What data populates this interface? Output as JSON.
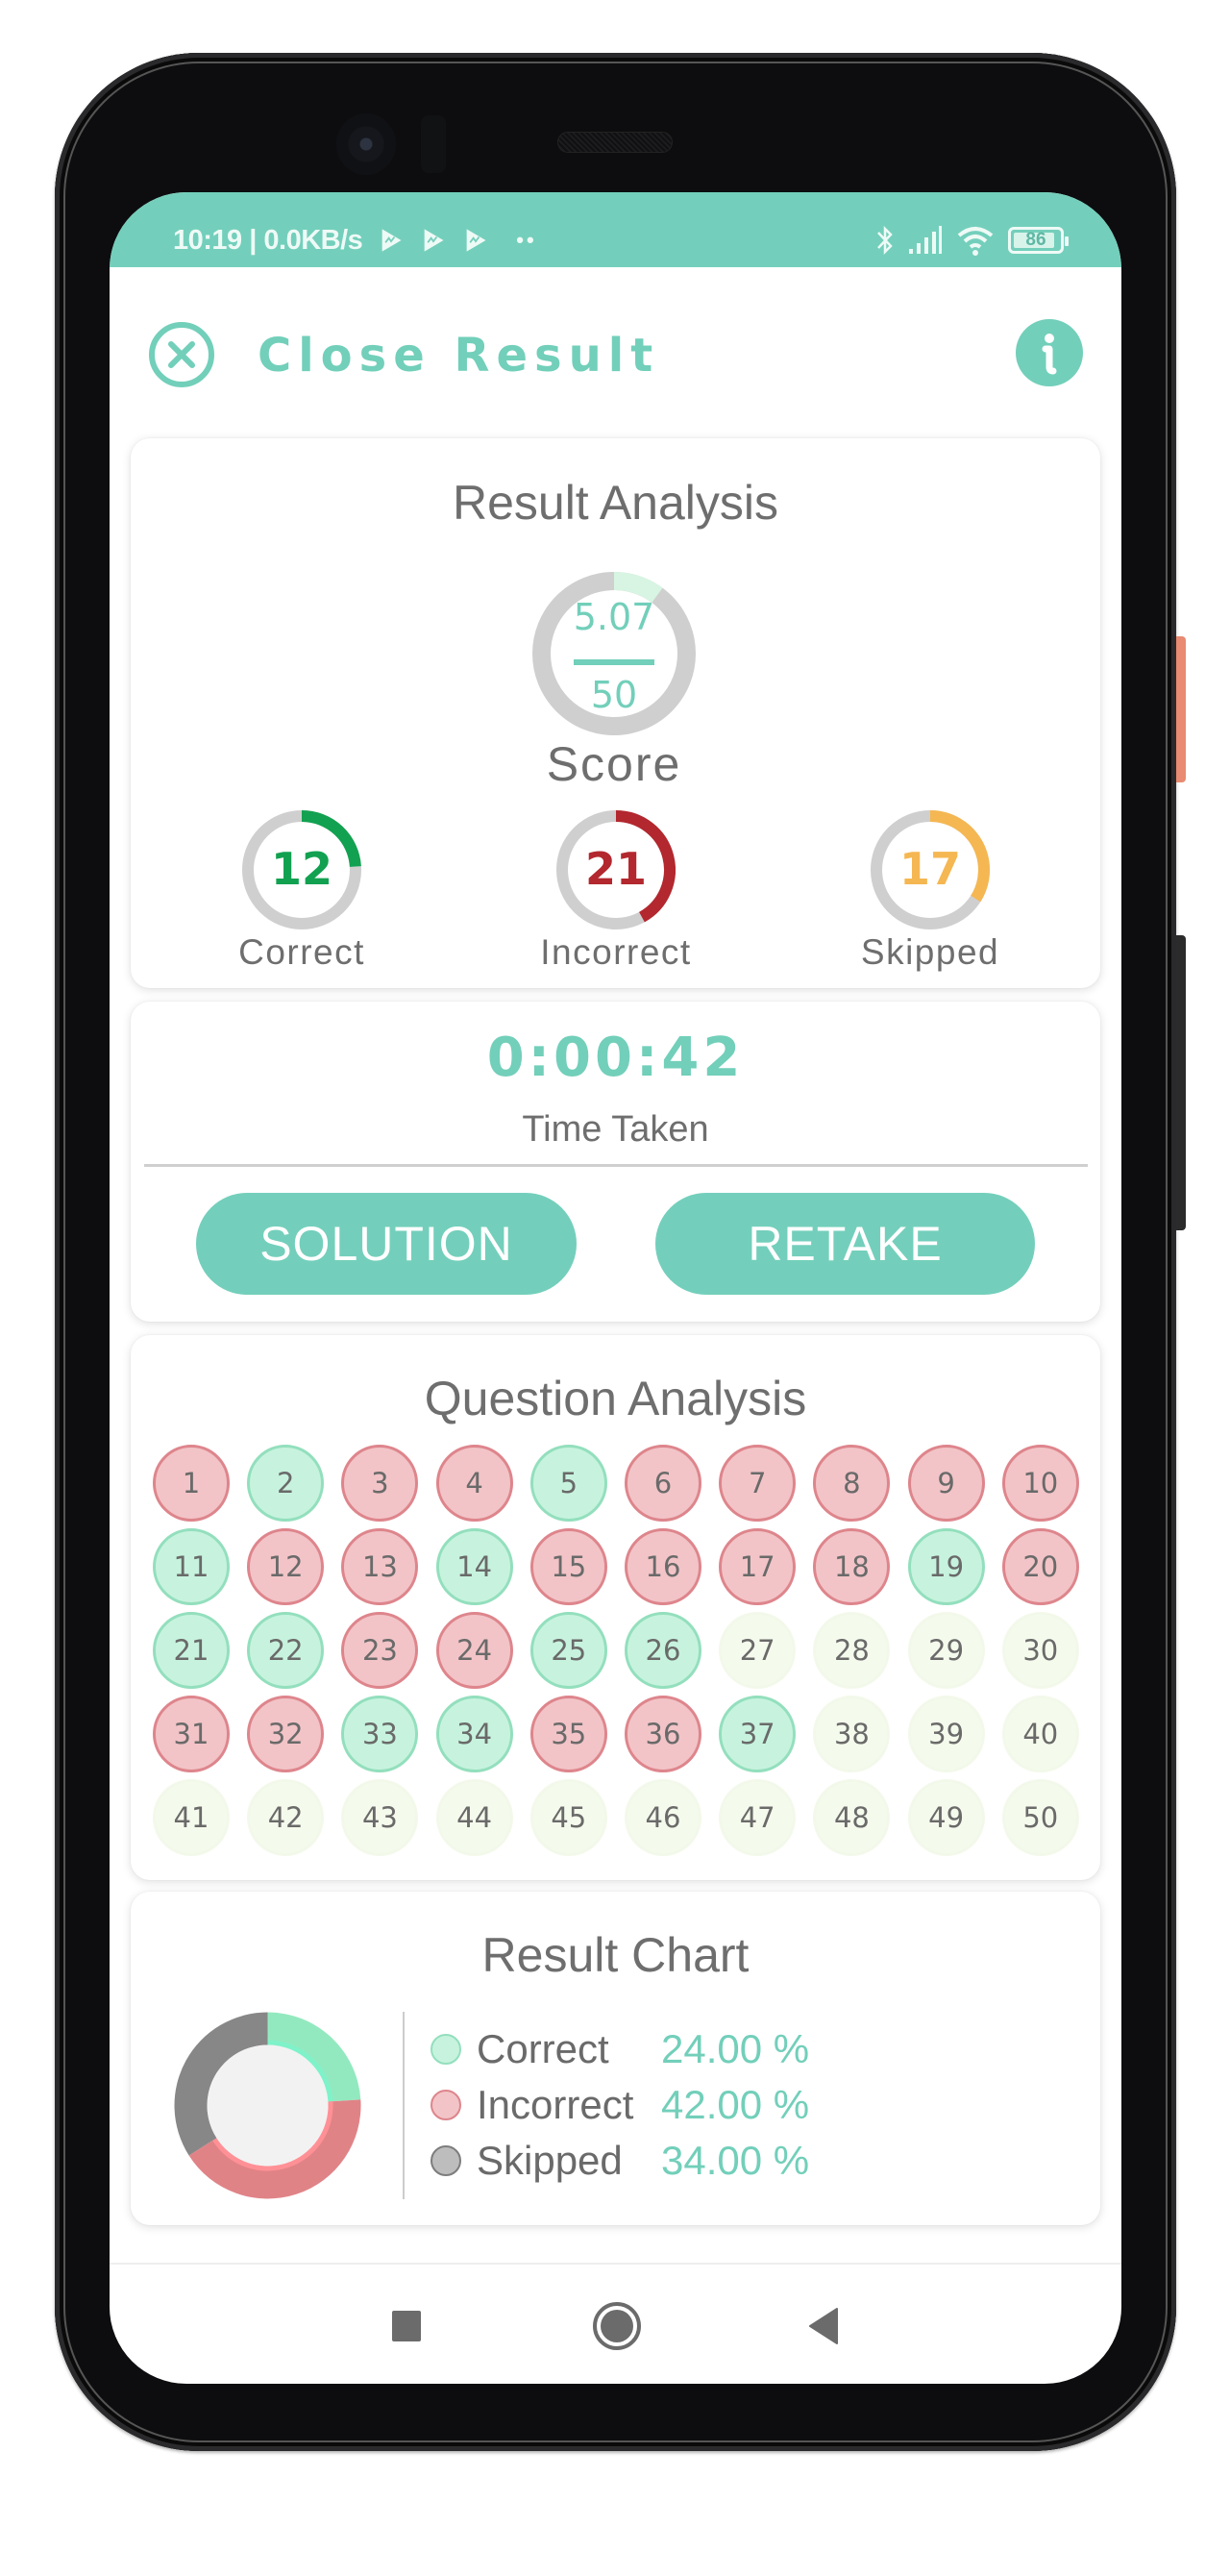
{
  "status_bar": {
    "time_speed": "10:19 | 0.0KB/s",
    "notification_icons": [
      "play-store-icon",
      "play-store-icon",
      "play-store-icon"
    ],
    "more_dots": "••",
    "battery_level": "86",
    "icons": [
      "bluetooth-icon",
      "signal-icon",
      "wifi-icon",
      "battery-icon"
    ]
  },
  "header": {
    "title": "Close Result",
    "close_icon": "close-circle-icon",
    "info_icon": "info-icon"
  },
  "result_analysis": {
    "title": "Result Analysis",
    "score": "5.07",
    "score_max": "50",
    "score_fraction": 0.1014,
    "score_label": "Score",
    "stats": [
      {
        "key": "correct",
        "value": "12",
        "label": "Correct",
        "fraction": 0.24,
        "color": "#12a150"
      },
      {
        "key": "incorrect",
        "value": "21",
        "label": "Incorrect",
        "fraction": 0.42,
        "color": "#b3272e"
      },
      {
        "key": "skipped",
        "value": "17",
        "label": "Skipped",
        "fraction": 0.34,
        "color": "#f5b752"
      }
    ]
  },
  "time": {
    "value": "0:00:42",
    "label": "Time Taken"
  },
  "actions": {
    "solution_label": "SOLUTION",
    "retake_label": "RETAKE"
  },
  "question_analysis": {
    "title": "Question Analysis",
    "questions": [
      {
        "n": "1",
        "s": "incorrect"
      },
      {
        "n": "2",
        "s": "correct"
      },
      {
        "n": "3",
        "s": "incorrect"
      },
      {
        "n": "4",
        "s": "incorrect"
      },
      {
        "n": "5",
        "s": "correct"
      },
      {
        "n": "6",
        "s": "incorrect"
      },
      {
        "n": "7",
        "s": "incorrect"
      },
      {
        "n": "8",
        "s": "incorrect"
      },
      {
        "n": "9",
        "s": "incorrect"
      },
      {
        "n": "10",
        "s": "incorrect"
      },
      {
        "n": "11",
        "s": "correct"
      },
      {
        "n": "12",
        "s": "incorrect"
      },
      {
        "n": "13",
        "s": "incorrect"
      },
      {
        "n": "14",
        "s": "correct"
      },
      {
        "n": "15",
        "s": "incorrect"
      },
      {
        "n": "16",
        "s": "incorrect"
      },
      {
        "n": "17",
        "s": "incorrect"
      },
      {
        "n": "18",
        "s": "incorrect"
      },
      {
        "n": "19",
        "s": "correct"
      },
      {
        "n": "20",
        "s": "incorrect"
      },
      {
        "n": "21",
        "s": "correct"
      },
      {
        "n": "22",
        "s": "correct"
      },
      {
        "n": "23",
        "s": "incorrect"
      },
      {
        "n": "24",
        "s": "incorrect"
      },
      {
        "n": "25",
        "s": "correct"
      },
      {
        "n": "26",
        "s": "correct"
      },
      {
        "n": "27",
        "s": "skipped"
      },
      {
        "n": "28",
        "s": "skipped"
      },
      {
        "n": "29",
        "s": "skipped"
      },
      {
        "n": "30",
        "s": "skipped"
      },
      {
        "n": "31",
        "s": "incorrect"
      },
      {
        "n": "32",
        "s": "incorrect"
      },
      {
        "n": "33",
        "s": "correct"
      },
      {
        "n": "34",
        "s": "correct"
      },
      {
        "n": "35",
        "s": "incorrect"
      },
      {
        "n": "36",
        "s": "incorrect"
      },
      {
        "n": "37",
        "s": "correct"
      },
      {
        "n": "38",
        "s": "skipped"
      },
      {
        "n": "39",
        "s": "skipped"
      },
      {
        "n": "40",
        "s": "skipped"
      },
      {
        "n": "41",
        "s": "skipped"
      },
      {
        "n": "42",
        "s": "skipped"
      },
      {
        "n": "43",
        "s": "skipped"
      },
      {
        "n": "44",
        "s": "skipped"
      },
      {
        "n": "45",
        "s": "skipped"
      },
      {
        "n": "46",
        "s": "skipped"
      },
      {
        "n": "47",
        "s": "skipped"
      },
      {
        "n": "48",
        "s": "skipped"
      },
      {
        "n": "49",
        "s": "skipped"
      },
      {
        "n": "50",
        "s": "skipped"
      }
    ]
  },
  "result_chart": {
    "title": "Result Chart",
    "legend": [
      {
        "label": "Correct",
        "value": "24.00 %",
        "dot_fill": "#c7f3de",
        "dot_border": "#93dfbd"
      },
      {
        "label": "Incorrect",
        "value": "42.00 %",
        "dot_fill": "#f2c4c7",
        "dot_border": "#de858c"
      },
      {
        "label": "Skipped",
        "value": "34.00 %",
        "dot_fill": "#bdbdbd",
        "dot_border": "#7d7d7d"
      }
    ]
  },
  "chart_data": {
    "type": "pie",
    "title": "Result Chart",
    "categories": [
      "Correct",
      "Incorrect",
      "Skipped"
    ],
    "values": [
      24.0,
      42.0,
      34.0
    ],
    "colors": [
      "#93e9bf",
      "#e08387",
      "#878787"
    ],
    "donut": true,
    "legend": "right"
  },
  "nav_bar": {
    "recent_icon": "recent-apps-icon",
    "home_icon": "home-icon",
    "back_icon": "back-icon"
  },
  "theme": {
    "accent": "#73cfbb"
  }
}
